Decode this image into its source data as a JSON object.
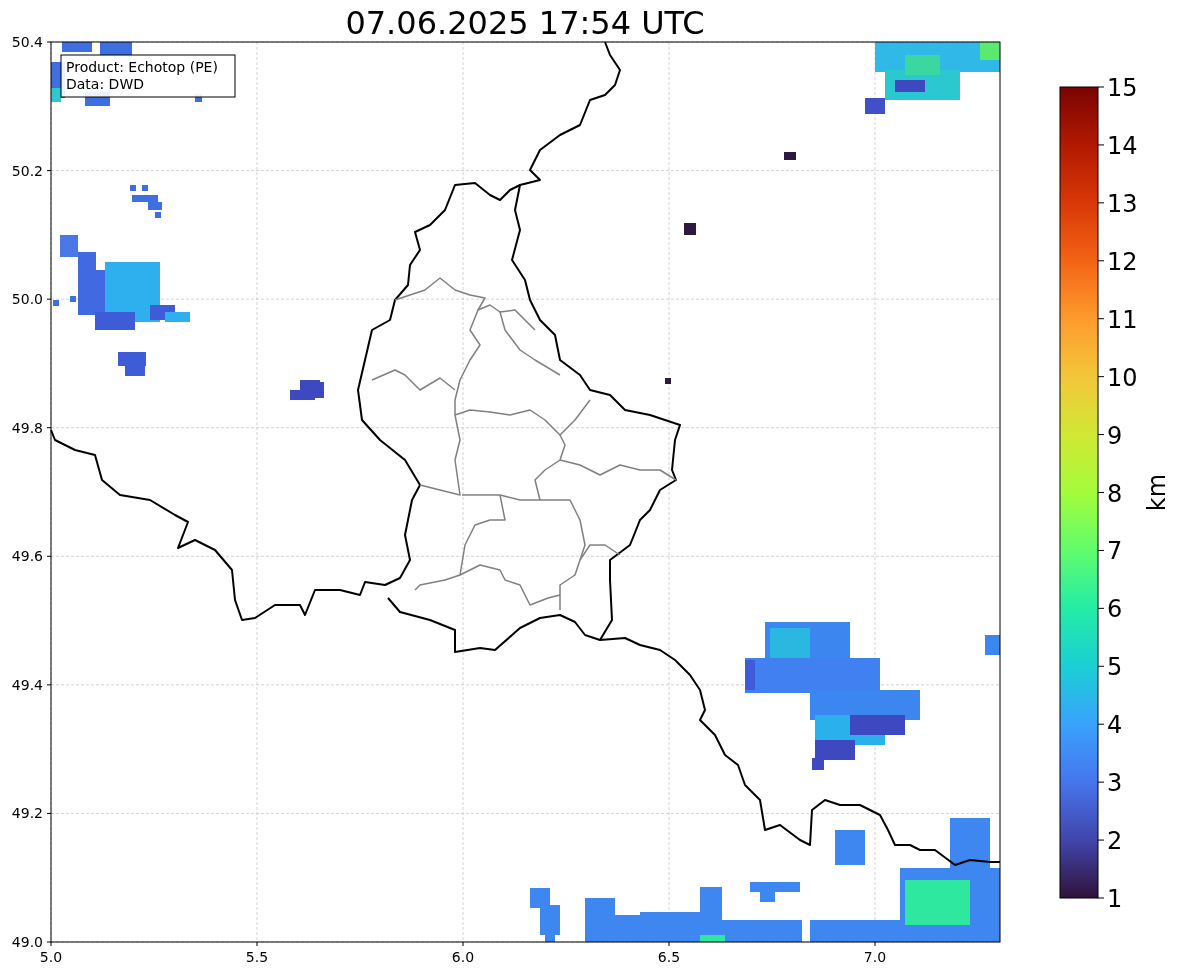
{
  "title": "07.06.2025 17:54 UTC",
  "legend": [
    "Product: Echotop (PE)",
    "Data: DWD"
  ],
  "map": {
    "y_ticks": [
      "50.4",
      "50.2",
      "50.0",
      "49.8",
      "49.6",
      "49.4",
      "49.2",
      "49.0"
    ],
    "x_ticks": [
      "5.0",
      "5.5",
      "6.0",
      "6.5",
      "7.0"
    ]
  },
  "colorbar": {
    "label": "km",
    "ticks": [
      "15",
      "14",
      "13",
      "12",
      "11",
      "10",
      "9",
      "8",
      "7",
      "6",
      "5",
      "4",
      "3",
      "2",
      "1"
    ]
  }
}
